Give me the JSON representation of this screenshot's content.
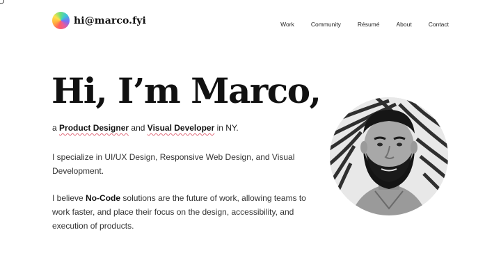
{
  "header": {
    "logo_text": "hi@marco.fyi",
    "nav": [
      "Work",
      "Community",
      "Résumé",
      "About",
      "Contact"
    ]
  },
  "hero": {
    "title": "Hi, I’m Marco,",
    "intro_prefix": "a",
    "role_1": "Product Designer",
    "intro_and": "and",
    "role_2": "Visual Developer",
    "intro_suffix": "in NY."
  },
  "paragraph_1": "I specialize in UI/UX Design, Responsive Web Design, and Visual Development.",
  "paragraph_2": {
    "before": "I believe",
    "highlight": "No-Code",
    "after": "solutions are the future of work, allowing teams to work faster, and place their focus on the design, accessibility, and execution of products."
  },
  "colors": {
    "text": "#111111",
    "underline_accent": "#e06a7a",
    "background": "#ffffff"
  },
  "icons": [
    "gradient-logo-icon"
  ]
}
